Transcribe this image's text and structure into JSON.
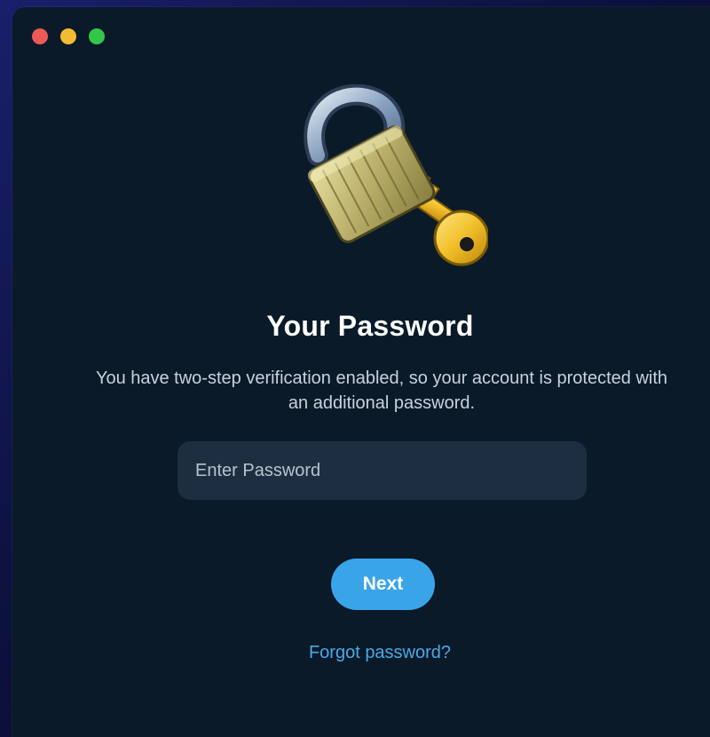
{
  "window": {
    "controls": [
      "close",
      "minimize",
      "maximize"
    ]
  },
  "icon": "locked-with-key-icon",
  "heading": "Your Password",
  "description": "You have two-step verification enabled, so your account is protected with an additional password.",
  "password_field": {
    "placeholder": "Enter Password",
    "value": ""
  },
  "next_button": "Next",
  "forgot_link": "Forgot password?",
  "colors": {
    "background": "#0a1a29",
    "accent": "#3aa4e8",
    "link": "#4ea7e6",
    "field": "#1d2e40"
  }
}
